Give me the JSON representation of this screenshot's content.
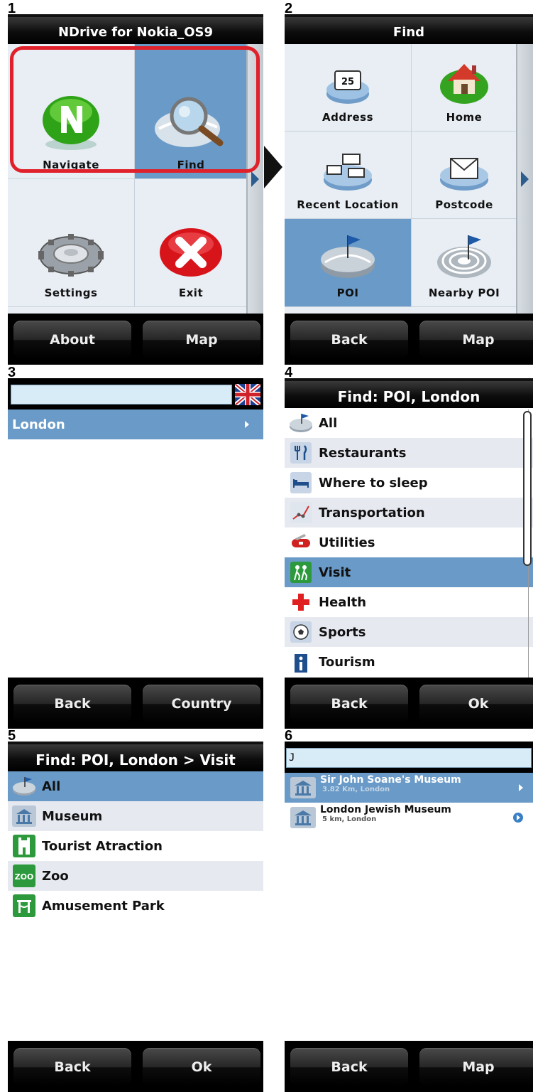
{
  "steps": [
    "1",
    "2",
    "3",
    "4",
    "5",
    "6"
  ],
  "panel1": {
    "title": "NDrive for Nokia_OS9",
    "tiles": [
      "Navigate",
      "Find",
      "Settings",
      "Exit"
    ],
    "buttons": {
      "left": "About",
      "right": "Map"
    }
  },
  "panel2": {
    "title": "Find",
    "tiles": [
      "Address",
      "Home",
      "Recent Location",
      "Postcode",
      "POI",
      "Nearby POI"
    ],
    "buttons": {
      "left": "Back",
      "right": "Map"
    }
  },
  "panel3": {
    "search_value": "",
    "items": [
      "London"
    ],
    "buttons": {
      "left": "Back",
      "right": "Country"
    }
  },
  "panel4": {
    "title": "Find: POI, London",
    "items": [
      "All",
      "Restaurants",
      "Where to sleep",
      "Transportation",
      "Utilities",
      "Visit",
      "Health",
      "Sports",
      "Tourism"
    ],
    "buttons": {
      "left": "Back",
      "right": "Ok"
    }
  },
  "panel5": {
    "title": "Find: POI, London > Visit",
    "items": [
      "All",
      "Museum",
      "Tourist Atraction",
      "Zoo",
      "Amusement Park"
    ],
    "buttons": {
      "left": "Back",
      "right": "Ok"
    }
  },
  "panel6": {
    "search_value": "J",
    "results": [
      {
        "name": "Sir John Soane's Museum",
        "detail": "3.82 Km, London"
      },
      {
        "name": "London Jewish Museum",
        "detail": "5 km, London"
      }
    ],
    "buttons": {
      "left": "Back",
      "right": "Map"
    }
  },
  "icons": {
    "address_number": "25",
    "zoo_label": "ZOO"
  },
  "colors": {
    "selection": "#6a9bc8",
    "highlight_frame": "#e0202a",
    "title_bar": "#000000"
  }
}
